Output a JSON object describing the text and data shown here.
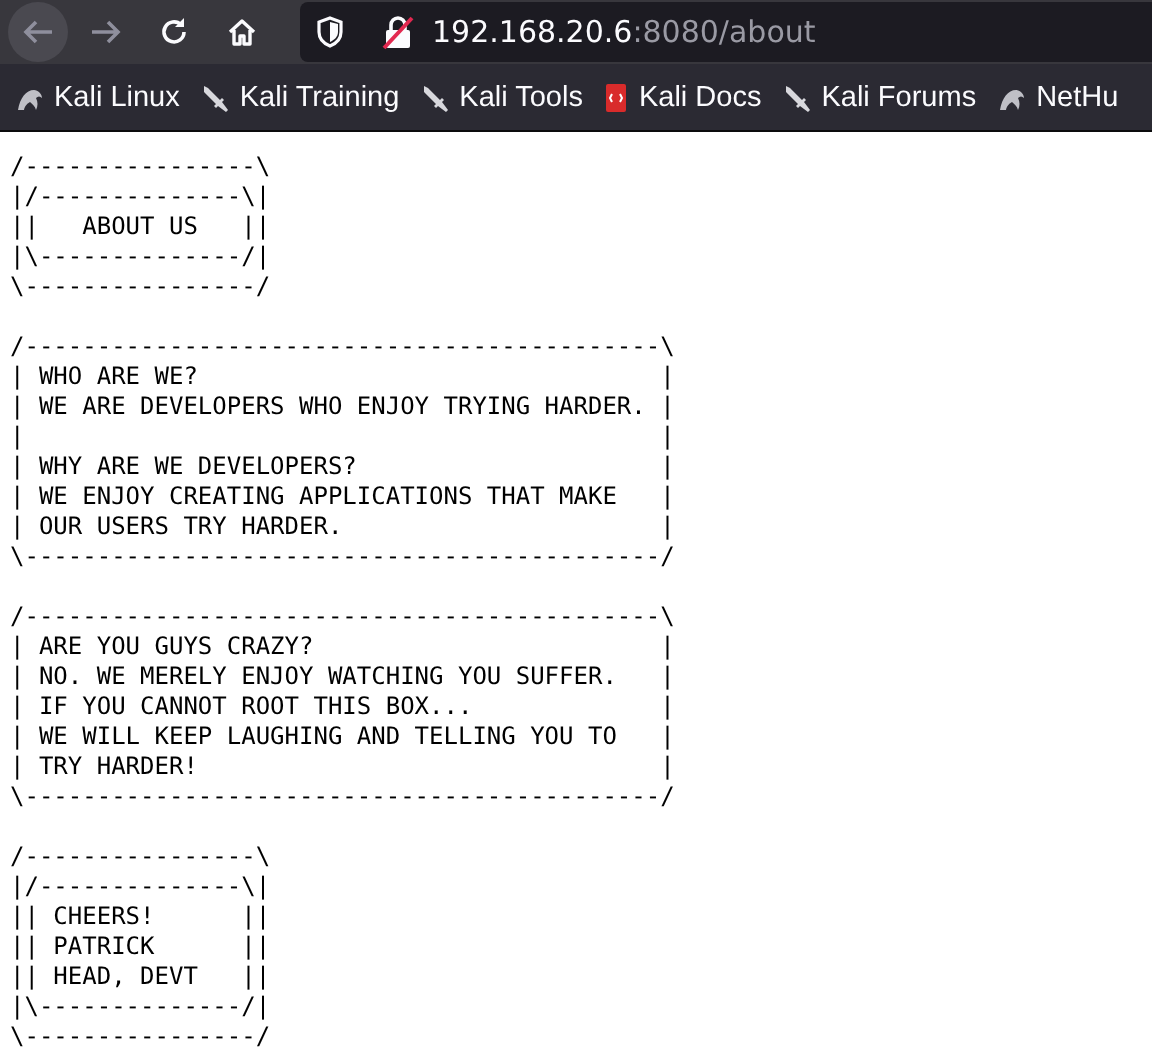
{
  "toolbar": {
    "nav": [
      {
        "kind": "back",
        "disabled": true
      },
      {
        "kind": "forward",
        "disabled": true
      },
      {
        "kind": "reload",
        "disabled": false
      },
      {
        "kind": "home",
        "disabled": false
      }
    ],
    "url": {
      "host": "192.168.20.6",
      "rest": ":8080/about"
    }
  },
  "bookmarks": [
    {
      "label": "Kali Linux",
      "kind": "dragon"
    },
    {
      "label": "Kali Training",
      "kind": "knife"
    },
    {
      "label": "Kali Tools",
      "kind": "knife"
    },
    {
      "label": "Kali Docs",
      "kind": "docs"
    },
    {
      "label": "Kali Forums",
      "kind": "knife"
    },
    {
      "label": "NetHu",
      "kind": "dragon"
    }
  ],
  "blocks": [
    {
      "lines": [
        "/----------------\\",
        "|/--------------\\|",
        "||   ABOUT US   ||",
        "|\\--------------/|",
        "\\----------------/"
      ]
    },
    {
      "lines": [
        "/--------------------------------------------\\",
        "| WHO ARE WE?                                |",
        "| WE ARE DEVELOPERS WHO ENJOY TRYING HARDER. |",
        "|                                            |",
        "| WHY ARE WE DEVELOPERS?                     |",
        "| WE ENJOY CREATING APPLICATIONS THAT MAKE   |",
        "| OUR USERS TRY HARDER.                      |",
        "\\--------------------------------------------/"
      ]
    },
    {
      "lines": [
        "/--------------------------------------------\\",
        "| ARE YOU GUYS CRAZY?                        |",
        "| NO. WE MERELY ENJOY WATCHING YOU SUFFER.   |",
        "| IF YOU CANNOT ROOT THIS BOX...             |",
        "| WE WILL KEEP LAUGHING AND TELLING YOU TO   |",
        "| TRY HARDER!                                |",
        "\\--------------------------------------------/"
      ]
    },
    {
      "lines": [
        "/----------------\\",
        "|/--------------\\|",
        "|| CHEERS!      ||",
        "|| PATRICK      ||",
        "|| HEAD, DEVT   ||",
        "|\\--------------/|",
        "\\----------------/"
      ]
    }
  ]
}
